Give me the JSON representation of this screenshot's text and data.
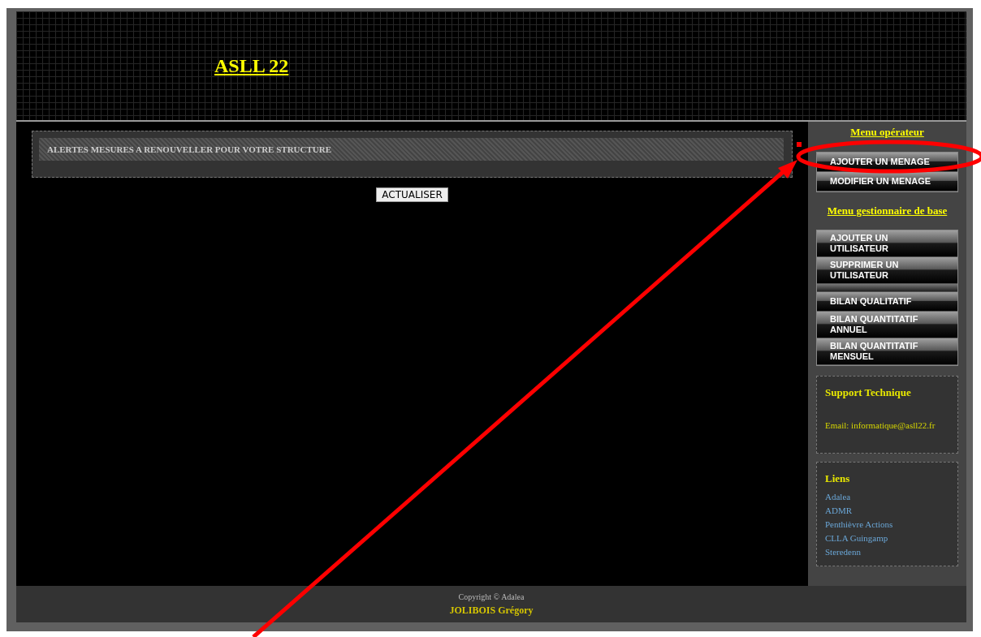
{
  "header": {
    "title": "ASLL 22"
  },
  "alerts": {
    "title": "ALERTES MESURES A RENOUVELLER POUR VOTRE STRUCTURE",
    "refresh_button": "ACTUALISER"
  },
  "sidebar": {
    "menus": [
      {
        "title": "Menu opérateur",
        "items": [
          {
            "kind": "button",
            "label": "AJOUTER UN MENAGE"
          },
          {
            "kind": "button",
            "label": "MODIFIER UN MENAGE"
          }
        ]
      },
      {
        "title": "Menu gestionnaire de base",
        "items": [
          {
            "kind": "button",
            "label": "AJOUTER UN UTILISATEUR"
          },
          {
            "kind": "button",
            "label": "SUPPRIMER UN UTILISATEUR"
          },
          {
            "kind": "separator"
          },
          {
            "kind": "button",
            "label": "BILAN QUALITATIF"
          },
          {
            "kind": "button",
            "label": "BILAN QUANTITATIF ANNUEL"
          },
          {
            "kind": "button",
            "label": "BILAN QUANTITATIF MENSUEL"
          }
        ]
      }
    ],
    "support": {
      "title": "Support Technique",
      "email": "Email: informatique@asll22.fr"
    },
    "links": {
      "title": "Liens",
      "items": [
        "Adalea",
        "ADMR",
        "Penthièvre Actions",
        "CLLA Guingamp",
        "Steredenn"
      ]
    }
  },
  "footer": {
    "copyright": "Copyright © Adalea",
    "author": "JOLIBOIS Grégory"
  }
}
